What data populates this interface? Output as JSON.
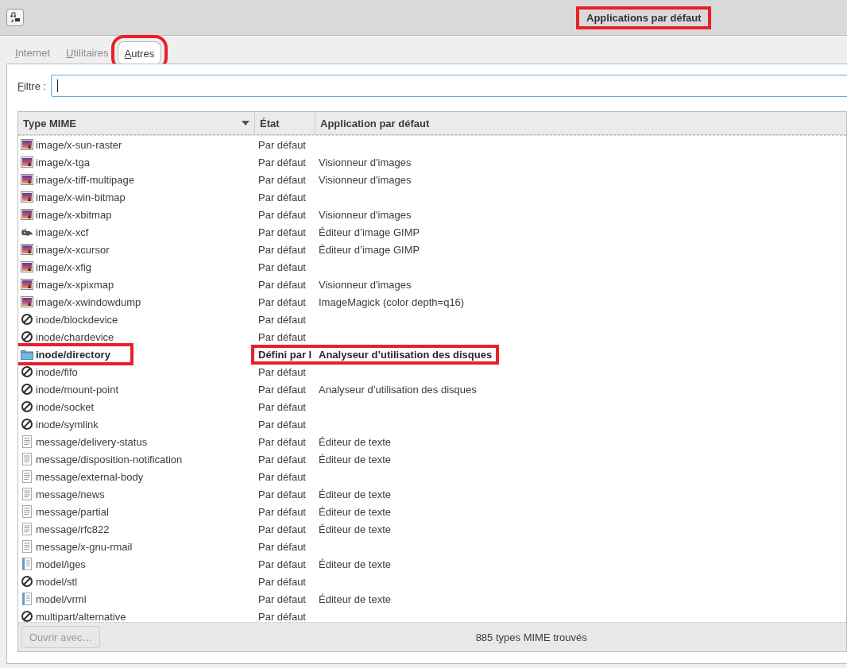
{
  "window": {
    "title": "Applications par défaut",
    "title_annotated": true
  },
  "tabs": [
    {
      "label": "Internet",
      "selected": false,
      "annotated": false
    },
    {
      "label": "Utilitaires",
      "selected": false,
      "annotated": false
    },
    {
      "label": "Autres",
      "selected": true,
      "annotated": true
    }
  ],
  "filter": {
    "label": "Filtre :",
    "focused": true
  },
  "table": {
    "columns": [
      {
        "label": "Type MIME",
        "sorted": true
      },
      {
        "label": "État",
        "sorted": false
      },
      {
        "label": "Application par défaut",
        "sorted": false
      }
    ],
    "rows": [
      {
        "kind": "image",
        "mime": "image/x-sun-raster",
        "state": "Par défaut",
        "user_defined": false,
        "annotated": false
      },
      {
        "kind": "image",
        "mime": "image/x-tga",
        "state": "Par défaut",
        "app": "Visionneur d'images",
        "user_defined": false,
        "annotated": false
      },
      {
        "kind": "image",
        "mime": "image/x-tiff-multipage",
        "state": "Par défaut",
        "app": "Visionneur d'images",
        "user_defined": false,
        "annotated": false
      },
      {
        "kind": "image",
        "mime": "image/x-win-bitmap",
        "state": "Par défaut",
        "user_defined": false,
        "annotated": false
      },
      {
        "kind": "image",
        "mime": "image/x-xbitmap",
        "state": "Par défaut",
        "app": "Visionneur d'images",
        "user_defined": false,
        "annotated": false
      },
      {
        "kind": "animal",
        "mime": "image/x-xcf",
        "state": "Par défaut",
        "app": "Éditeur d’image GIMP",
        "user_defined": false,
        "annotated": false
      },
      {
        "kind": "image",
        "mime": "image/x-xcursor",
        "state": "Par défaut",
        "app": "Éditeur d’image GIMP",
        "user_defined": false,
        "annotated": false
      },
      {
        "kind": "image",
        "mime": "image/x-xfig",
        "state": "Par défaut",
        "user_defined": false,
        "annotated": false
      },
      {
        "kind": "image",
        "mime": "image/x-xpixmap",
        "state": "Par défaut",
        "app": "Visionneur d'images",
        "user_defined": false,
        "annotated": false
      },
      {
        "kind": "image",
        "mime": "image/x-xwindowdump",
        "state": "Par défaut",
        "app": "ImageMagick (color depth=q16)",
        "user_defined": false,
        "annotated": false
      },
      {
        "kind": "blocked",
        "mime": "inode/blockdevice",
        "state": "Par défaut",
        "user_defined": false,
        "annotated": false
      },
      {
        "kind": "blocked",
        "mime": "inode/chardevice",
        "state": "Par défaut",
        "user_defined": false,
        "annotated": false
      },
      {
        "kind": "folder",
        "mime": "inode/directory",
        "state": "Défini par l",
        "app": "Analyseur d’utilisation des disques",
        "user_defined": true,
        "annotated": true
      },
      {
        "kind": "blocked",
        "mime": "inode/fifo",
        "state": "Par défaut",
        "user_defined": false,
        "annotated": false
      },
      {
        "kind": "blocked",
        "mime": "inode/mount-point",
        "state": "Par défaut",
        "app": "Analyseur d’utilisation des disques",
        "user_defined": false,
        "annotated": false
      },
      {
        "kind": "blocked",
        "mime": "inode/socket",
        "state": "Par défaut",
        "user_defined": false,
        "annotated": false
      },
      {
        "kind": "blocked",
        "mime": "inode/symlink",
        "state": "Par défaut",
        "user_defined": false,
        "annotated": false
      },
      {
        "kind": "text",
        "mime": "message/delivery-status",
        "state": "Par défaut",
        "app": "Éditeur de texte",
        "user_defined": false,
        "annotated": false
      },
      {
        "kind": "text",
        "mime": "message/disposition-notification",
        "state": "Par défaut",
        "app": "Éditeur de texte",
        "user_defined": false,
        "annotated": false
      },
      {
        "kind": "text",
        "mime": "message/external-body",
        "state": "Par défaut",
        "user_defined": false,
        "annotated": false
      },
      {
        "kind": "text",
        "mime": "message/news",
        "state": "Par défaut",
        "app": "Éditeur de texte",
        "user_defined": false,
        "annotated": false
      },
      {
        "kind": "text",
        "mime": "message/partial",
        "state": "Par défaut",
        "app": "Éditeur de texte",
        "user_defined": false,
        "annotated": false
      },
      {
        "kind": "text",
        "mime": "message/rfc822",
        "state": "Par défaut",
        "app": "Éditeur de texte",
        "user_defined": false,
        "annotated": false
      },
      {
        "kind": "text",
        "mime": "message/x-gnu-rmail",
        "state": "Par défaut",
        "user_defined": false,
        "annotated": false
      },
      {
        "kind": "notebook",
        "mime": "model/iges",
        "state": "Par défaut",
        "app": "Éditeur de texte",
        "user_defined": false,
        "annotated": false
      },
      {
        "kind": "blocked",
        "mime": "model/stl",
        "state": "Par défaut",
        "user_defined": false,
        "annotated": false
      },
      {
        "kind": "notebook",
        "mime": "model/vrml",
        "state": "Par défaut",
        "app": "Éditeur de texte",
        "user_defined": false,
        "annotated": false
      },
      {
        "kind": "blocked",
        "mime": "multipart/alternative",
        "state": "Par défaut",
        "user_defined": false,
        "annotated": false
      }
    ]
  },
  "open_with_button": {
    "label": "Ouvrir avec…",
    "disabled": true
  },
  "status": "885 types MIME trouvés"
}
